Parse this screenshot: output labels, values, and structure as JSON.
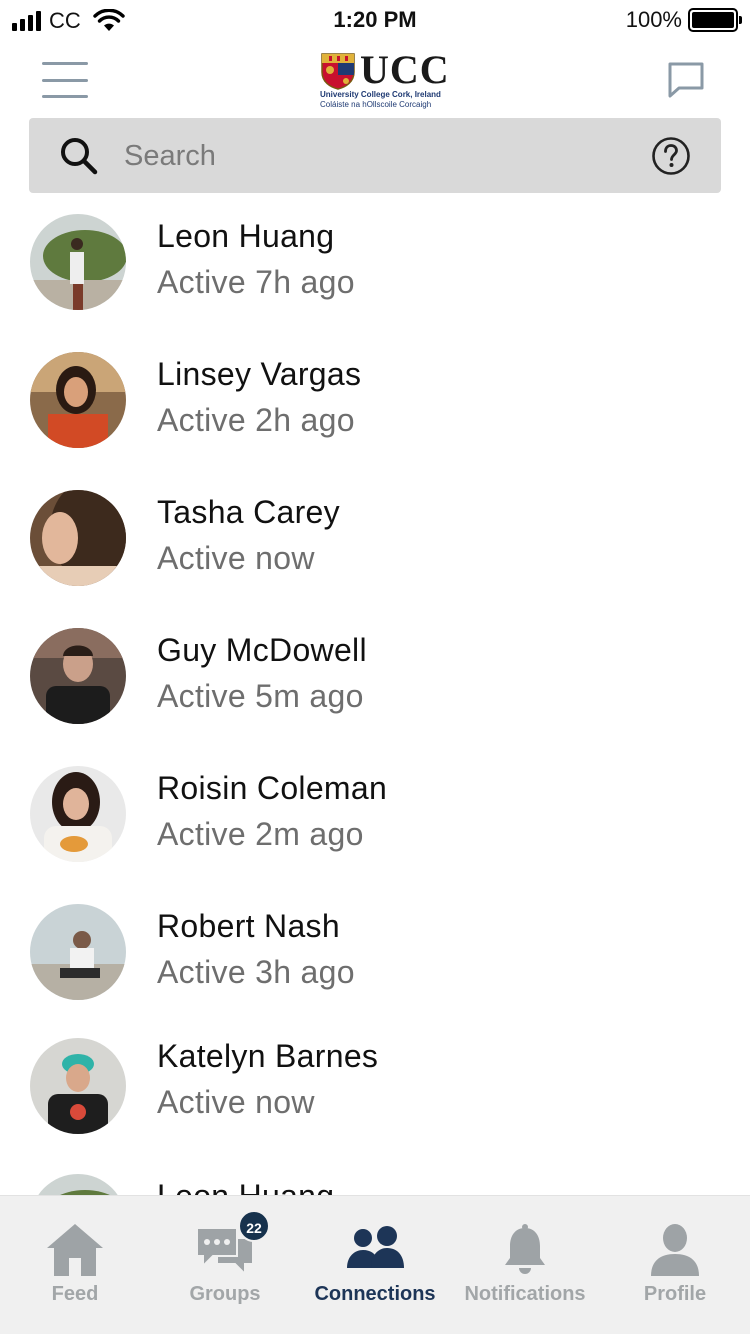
{
  "status_bar": {
    "carrier": "CC",
    "time": "1:20 PM",
    "battery_percent": "100%"
  },
  "header": {
    "logo_word": "UCC",
    "logo_line1": "University College Cork, Ireland",
    "logo_line2": "Coláiste na hOllscoile Corcaigh"
  },
  "search": {
    "placeholder": "Search"
  },
  "connections": [
    {
      "name": "Leon Huang",
      "status": "Active 7h ago",
      "avatar_icon": "avatar-photo-icon"
    },
    {
      "name": "Linsey Vargas",
      "status": "Active 2h ago",
      "avatar_icon": "avatar-photo-icon"
    },
    {
      "name": "Tasha Carey",
      "status": "Active now",
      "avatar_icon": "avatar-photo-icon"
    },
    {
      "name": "Guy McDowell",
      "status": "Active 5m ago",
      "avatar_icon": "avatar-photo-icon"
    },
    {
      "name": "Roisin Coleman",
      "status": "Active 2m ago",
      "avatar_icon": "avatar-photo-icon"
    },
    {
      "name": "Robert Nash",
      "status": "Active 3h ago",
      "avatar_icon": "avatar-photo-icon"
    },
    {
      "name": "Katelyn Barnes",
      "status": "Active now",
      "avatar_icon": "avatar-photo-icon"
    },
    {
      "name": "Leon Huang",
      "status": "",
      "avatar_icon": "avatar-photo-icon"
    }
  ],
  "tabs": [
    {
      "label": "Feed",
      "icon": "home-icon",
      "active": false
    },
    {
      "label": "Groups",
      "icon": "groups-chat-icon",
      "active": false,
      "badge": "22"
    },
    {
      "label": "Connections",
      "icon": "connections-people-icon",
      "active": true
    },
    {
      "label": "Notifications",
      "icon": "bell-icon",
      "active": false
    },
    {
      "label": "Profile",
      "icon": "profile-icon",
      "active": false
    }
  ],
  "colors": {
    "active_tab": "#1d3557",
    "inactive_tab": "#a2a6a8",
    "badge_bg": "#17324d",
    "search_bg": "#d9d9d9",
    "tab_bar_bg": "#f0f0f0",
    "status_text": "#6e6e6e"
  }
}
